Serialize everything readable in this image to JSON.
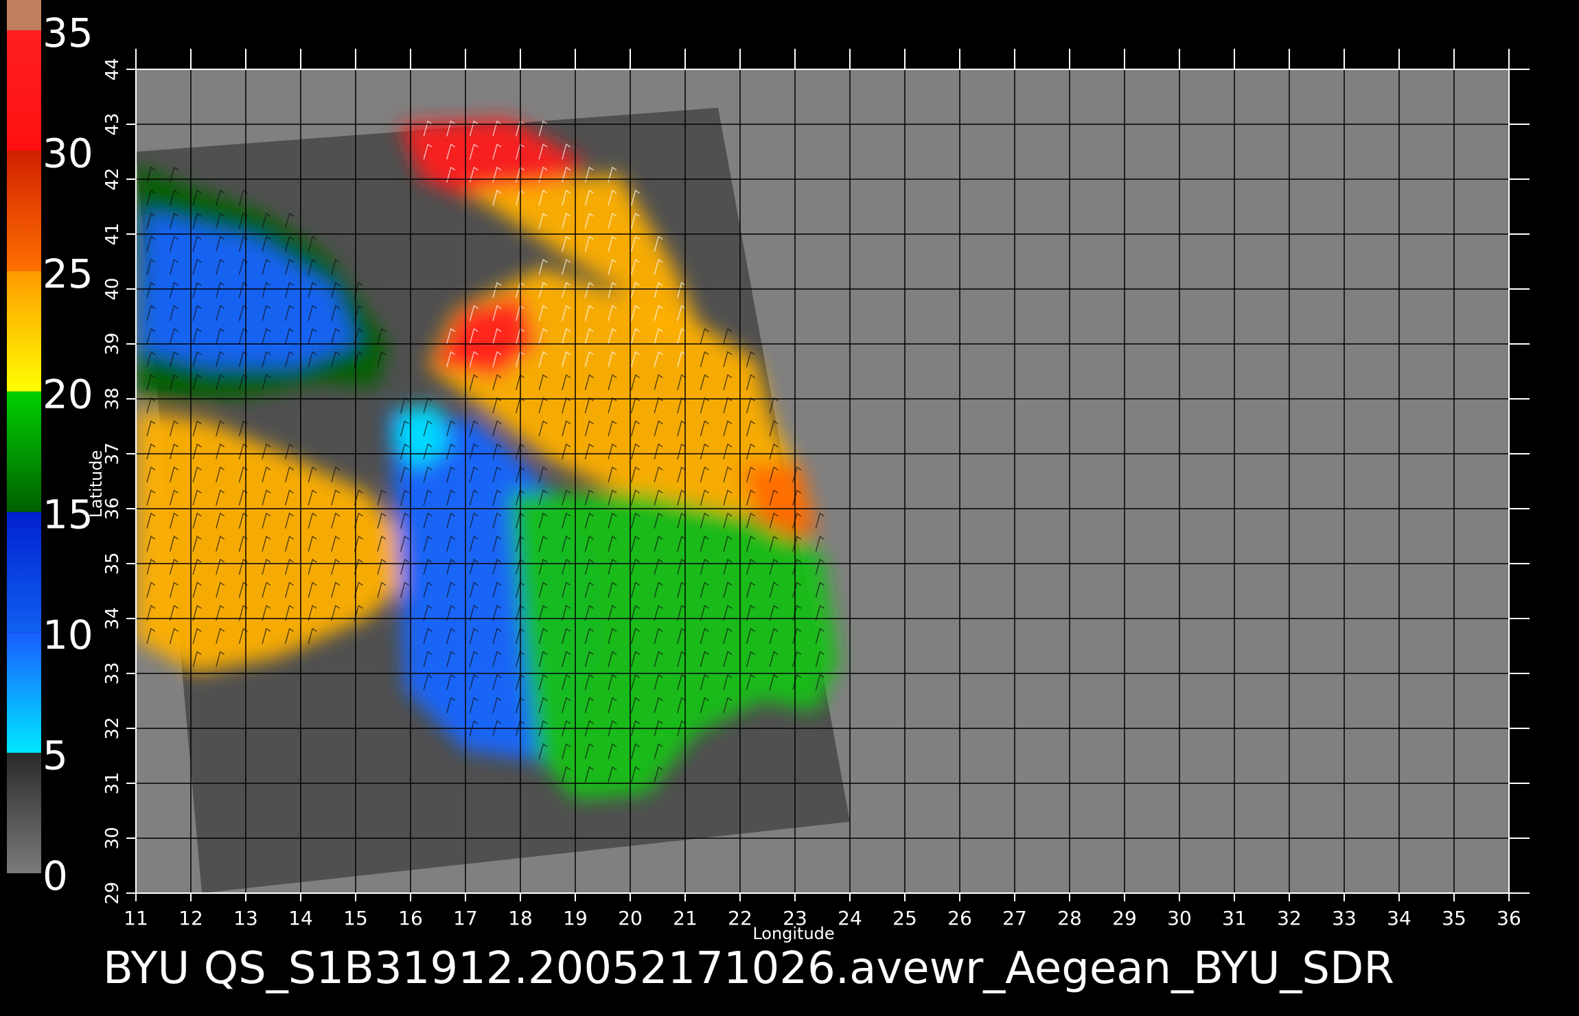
{
  "figure": {
    "caption": "BYU  QS_S1B31912.20052171026.avewr_Aegean_BYU_SDR",
    "xlabel": "Longitude",
    "ylabel": "Latitude"
  },
  "colorbar": {
    "tick_labels": [
      "35",
      "30",
      "25",
      "20",
      "15",
      "10",
      "5",
      "0"
    ],
    "range": [
      0,
      35
    ],
    "bands": [
      {
        "from": 0,
        "to": 5,
        "colors": [
          "#7a7a7a",
          "#2a2a2a"
        ]
      },
      {
        "from": 5,
        "to": 10,
        "colors": [
          "#00e8ff",
          "#1a5cff"
        ]
      },
      {
        "from": 10,
        "to": 15,
        "colors": [
          "#1060f0",
          "#0020d0"
        ]
      },
      {
        "from": 15,
        "to": 20,
        "colors": [
          "#006000",
          "#00d000"
        ]
      },
      {
        "from": 20,
        "to": 25,
        "colors": [
          "#ffff00",
          "#ff9a00"
        ]
      },
      {
        "from": 25,
        "to": 30,
        "colors": [
          "#ff7000",
          "#d02000"
        ]
      },
      {
        "from": 30,
        "to": 35,
        "colors": [
          "#ff1010",
          "#ff2020"
        ]
      }
    ],
    "top_cap_color": "#c08060"
  },
  "map": {
    "lon_ticks": [
      11,
      12,
      13,
      14,
      15,
      16,
      17,
      18,
      19,
      20,
      21,
      22,
      23,
      24,
      25,
      26,
      27,
      28,
      29,
      30,
      31,
      32,
      33,
      34,
      35,
      36
    ],
    "lat_ticks": [
      29,
      30,
      31,
      32,
      33,
      34,
      35,
      36,
      37,
      38,
      39,
      40,
      41,
      42,
      43,
      44
    ],
    "lon_range": [
      11,
      36
    ],
    "lat_range": [
      29,
      44
    ],
    "background_color": "#808080",
    "swath_color": "#505050",
    "grid_color": "#000000",
    "swath_corners": [
      [
        11.0,
        42.5
      ],
      [
        21.6,
        43.3
      ],
      [
        24.0,
        30.3
      ],
      [
        12.2,
        29.0
      ]
    ]
  },
  "chart_data": {
    "type": "heatmap",
    "title": "BYU  QS_S1B31912.20052171026.avewr_Aegean_BYU_SDR",
    "xlabel": "Longitude",
    "ylabel": "Latitude",
    "xlim": [
      11,
      36
    ],
    "ylim": [
      29,
      44
    ],
    "colorbar_ticks": [
      0,
      5,
      10,
      15,
      20,
      25,
      30,
      35
    ],
    "regions": [
      {
        "name": "",
        "value": 30,
        "polygon": [
          [
            15.8,
            43.0
          ],
          [
            17.8,
            43.1
          ],
          [
            19.2,
            42.3
          ],
          [
            18.3,
            41.6
          ],
          [
            17.2,
            41.6
          ],
          [
            16.2,
            42.0
          ],
          [
            15.8,
            43.0
          ]
        ]
      },
      {
        "name": "",
        "value": 24,
        "polygon": [
          [
            17.0,
            41.8
          ],
          [
            19.8,
            42.1
          ],
          [
            20.8,
            40.4
          ],
          [
            21.3,
            39.2
          ],
          [
            20.4,
            39.1
          ],
          [
            19.8,
            40.0
          ],
          [
            18.8,
            40.6
          ],
          [
            17.0,
            41.8
          ]
        ]
      },
      {
        "name": "",
        "value": 24,
        "polygon": [
          [
            16.8,
            39.6
          ],
          [
            18.4,
            40.4
          ],
          [
            19.8,
            39.9
          ],
          [
            21.2,
            39.4
          ],
          [
            22.3,
            38.7
          ],
          [
            22.6,
            37.6
          ],
          [
            23.1,
            36.6
          ],
          [
            23.3,
            35.8
          ],
          [
            21.8,
            35.9
          ],
          [
            20.2,
            36.1
          ],
          [
            18.5,
            36.9
          ],
          [
            17.2,
            37.9
          ],
          [
            16.3,
            38.6
          ],
          [
            16.8,
            39.6
          ]
        ]
      },
      {
        "name": "",
        "value": 31,
        "polygon": [
          [
            16.9,
            39.6
          ],
          [
            18.0,
            39.9
          ],
          [
            18.3,
            39.0
          ],
          [
            17.6,
            38.4
          ],
          [
            16.4,
            38.6
          ],
          [
            16.9,
            39.6
          ]
        ]
      },
      {
        "name": "",
        "value": 29,
        "polygon": [
          [
            22.0,
            36.8
          ],
          [
            23.1,
            36.8
          ],
          [
            23.4,
            35.6
          ],
          [
            22.5,
            35.3
          ],
          [
            22.0,
            36.8
          ]
        ]
      },
      {
        "name": "",
        "value": 17,
        "polygon": [
          [
            11.0,
            42.3
          ],
          [
            11.6,
            42.0
          ],
          [
            13.3,
            41.4
          ],
          [
            14.5,
            40.6
          ],
          [
            15.6,
            39.0
          ],
          [
            15.4,
            38.2
          ],
          [
            14.3,
            38.3
          ],
          [
            12.8,
            38.0
          ],
          [
            11.0,
            38.0
          ]
        ]
      },
      {
        "name": "",
        "value": 11,
        "polygon": [
          [
            11.2,
            41.4
          ],
          [
            13.2,
            40.9
          ],
          [
            14.6,
            40.0
          ],
          [
            15.0,
            39.0
          ],
          [
            13.9,
            38.6
          ],
          [
            12.3,
            38.6
          ],
          [
            11.1,
            38.9
          ],
          [
            11.2,
            41.4
          ]
        ]
      },
      {
        "name": "",
        "value": 24,
        "polygon": [
          [
            11.0,
            37.8
          ],
          [
            12.3,
            37.6
          ],
          [
            13.7,
            37.0
          ],
          [
            15.2,
            36.3
          ],
          [
            15.8,
            35.6
          ],
          [
            15.9,
            34.6
          ],
          [
            15.2,
            34.0
          ],
          [
            13.6,
            33.3
          ],
          [
            12.1,
            33.0
          ],
          [
            11.0,
            33.6
          ]
        ]
      },
      {
        "name": "",
        "value": 10,
        "polygon": [
          [
            15.6,
            37.8
          ],
          [
            17.2,
            37.6
          ],
          [
            18.3,
            36.6
          ],
          [
            19.3,
            35.1
          ],
          [
            19.4,
            33.5
          ],
          [
            19.0,
            32.0
          ],
          [
            18.4,
            31.4
          ],
          [
            17.0,
            31.6
          ],
          [
            15.9,
            32.7
          ],
          [
            15.8,
            34.7
          ],
          [
            15.6,
            37.8
          ]
        ]
      },
      {
        "name": "",
        "value": 18,
        "polygon": [
          [
            17.8,
            36.3
          ],
          [
            20.2,
            36.3
          ],
          [
            22.0,
            35.9
          ],
          [
            23.5,
            35.2
          ],
          [
            23.8,
            33.2
          ],
          [
            23.4,
            32.3
          ],
          [
            22.4,
            32.5
          ],
          [
            21.2,
            31.9
          ],
          [
            20.8,
            31.4
          ],
          [
            20.3,
            30.8
          ],
          [
            19.0,
            30.7
          ],
          [
            18.3,
            31.5
          ],
          [
            18.0,
            34.0
          ],
          [
            17.8,
            36.3
          ]
        ]
      },
      {
        "name": "",
        "value": 6,
        "polygon": [
          [
            15.8,
            37.8
          ],
          [
            16.5,
            37.9
          ],
          [
            16.7,
            37.1
          ],
          [
            16.1,
            36.7
          ],
          [
            15.7,
            37.2
          ],
          [
            15.8,
            37.8
          ]
        ]
      }
    ]
  }
}
